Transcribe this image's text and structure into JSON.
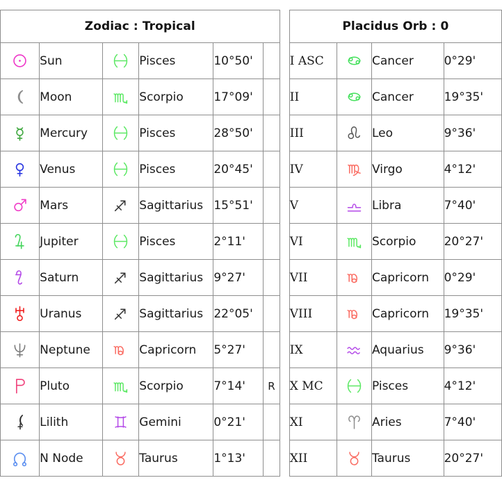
{
  "left_panel": {
    "title": "Zodiac : Tropical",
    "columns": [
      "planet_symbol",
      "planet",
      "sign_symbol",
      "sign",
      "position",
      "retrograde"
    ],
    "rows": [
      {
        "planet_symbol": "sun-symbol",
        "planet": "Sun",
        "sign_symbol": "pisces-symbol",
        "sign": "Pisces",
        "position": "10°50'",
        "retrograde": ""
      },
      {
        "planet_symbol": "moon-symbol",
        "planet": "Moon",
        "sign_symbol": "scorpio-symbol",
        "sign": "Scorpio",
        "position": "17°09'",
        "retrograde": ""
      },
      {
        "planet_symbol": "mercury-symbol",
        "planet": "Mercury",
        "sign_symbol": "pisces-symbol",
        "sign": "Pisces",
        "position": "28°50'",
        "retrograde": ""
      },
      {
        "planet_symbol": "venus-symbol",
        "planet": "Venus",
        "sign_symbol": "pisces-symbol",
        "sign": "Pisces",
        "position": "20°45'",
        "retrograde": ""
      },
      {
        "planet_symbol": "mars-symbol",
        "planet": "Mars",
        "sign_symbol": "sagittarius-symbol",
        "sign": "Sagittarius",
        "position": "15°51'",
        "retrograde": ""
      },
      {
        "planet_symbol": "jupiter-symbol",
        "planet": "Jupiter",
        "sign_symbol": "pisces-symbol",
        "sign": "Pisces",
        "position": "2°11'",
        "retrograde": ""
      },
      {
        "planet_symbol": "saturn-symbol",
        "planet": "Saturn",
        "sign_symbol": "sagittarius-symbol",
        "sign": "Sagittarius",
        "position": "9°27'",
        "retrograde": ""
      },
      {
        "planet_symbol": "uranus-symbol",
        "planet": "Uranus",
        "sign_symbol": "sagittarius-symbol",
        "sign": "Sagittarius",
        "position": "22°05'",
        "retrograde": ""
      },
      {
        "planet_symbol": "neptune-symbol",
        "planet": "Neptune",
        "sign_symbol": "capricorn-symbol",
        "sign": "Capricorn",
        "position": "5°27'",
        "retrograde": ""
      },
      {
        "planet_symbol": "pluto-symbol",
        "planet": "Pluto",
        "sign_symbol": "scorpio-symbol",
        "sign": "Scorpio",
        "position": "7°14'",
        "retrograde": "R"
      },
      {
        "planet_symbol": "lilith-symbol",
        "planet": "Lilith",
        "sign_symbol": "gemini-symbol",
        "sign": "Gemini",
        "position": "0°21'",
        "retrograde": ""
      },
      {
        "planet_symbol": "north-node-symbol",
        "planet": "N Node",
        "sign_symbol": "taurus-symbol",
        "sign": "Taurus",
        "position": "1°13'",
        "retrograde": ""
      }
    ]
  },
  "right_panel": {
    "title": "Placidus Orb : 0",
    "columns": [
      "house",
      "sign_symbol",
      "sign",
      "position"
    ],
    "rows": [
      {
        "house": "I ASC",
        "sign_symbol": "cancer-symbol",
        "sign": "Cancer",
        "position": "0°29'"
      },
      {
        "house": "II",
        "sign_symbol": "cancer-symbol",
        "sign": "Cancer",
        "position": "19°35'"
      },
      {
        "house": "III",
        "sign_symbol": "leo-symbol",
        "sign": "Leo",
        "position": "9°36'"
      },
      {
        "house": "IV",
        "sign_symbol": "virgo-symbol",
        "sign": "Virgo",
        "position": "4°12'"
      },
      {
        "house": "V",
        "sign_symbol": "libra-symbol",
        "sign": "Libra",
        "position": "7°40'"
      },
      {
        "house": "VI",
        "sign_symbol": "scorpio-symbol",
        "sign": "Scorpio",
        "position": "20°27'"
      },
      {
        "house": "VII",
        "sign_symbol": "capricorn-symbol",
        "sign": "Capricorn",
        "position": "0°29'"
      },
      {
        "house": "VIII",
        "sign_symbol": "capricorn-symbol",
        "sign": "Capricorn",
        "position": "19°35'"
      },
      {
        "house": "IX",
        "sign_symbol": "aquarius-symbol",
        "sign": "Aquarius",
        "position": "9°36'"
      },
      {
        "house": "X MC",
        "sign_symbol": "pisces-symbol",
        "sign": "Pisces",
        "position": "4°12'"
      },
      {
        "house": "XI",
        "sign_symbol": "aries-symbol",
        "sign": "Aries",
        "position": "7°40'"
      },
      {
        "house": "XII",
        "sign_symbol": "taurus-symbol",
        "sign": "Taurus",
        "position": "20°27'"
      }
    ]
  },
  "glyph_colors": {
    "sun-symbol": "#ee36c8",
    "moon-symbol": "#8e8e8e",
    "mercury-symbol": "#3fa83f",
    "venus-symbol": "#2633e0",
    "mars-symbol": "#f03fc8",
    "jupiter-symbol": "#44d45c",
    "saturn-symbol": "#b44ae8",
    "uranus-symbol": "#f02020",
    "neptune-symbol": "#7d7d7d",
    "pluto-symbol": "#f0407a",
    "lilith-symbol": "#333333",
    "north-node-symbol": "#5a8ef0",
    "aries-symbol": "#8e8e8e",
    "taurus-symbol": "#fa6a60",
    "gemini-symbol": "#b44ae8",
    "cancer-symbol": "#44e05c",
    "leo-symbol": "#555555",
    "virgo-symbol": "#fa6a60",
    "libra-symbol": "#b44ae8",
    "scorpio-symbol": "#5ce864",
    "sagittarius-symbol": "#333333",
    "capricorn-symbol": "#fa6a60",
    "aquarius-symbol": "#b44ae8",
    "pisces-symbol": "#5ce864"
  },
  "glyph_chars": {
    "sun-symbol": "☉",
    "moon-symbol": "☽",
    "mercury-symbol": "☿",
    "venus-symbol": "♀",
    "mars-symbol": "♂",
    "jupiter-symbol": "♃",
    "saturn-symbol": "♄",
    "uranus-symbol": "⛢",
    "neptune-symbol": "♆",
    "pluto-symbol": "♇",
    "lilith-symbol": "⚸",
    "north-node-symbol": "☊",
    "aries-symbol": "♈",
    "taurus-symbol": "♉",
    "gemini-symbol": "♊",
    "cancer-symbol": "♋",
    "leo-symbol": "♌",
    "virgo-symbol": "♍",
    "libra-symbol": "♎",
    "scorpio-symbol": "♏",
    "sagittarius-symbol": "♐",
    "capricorn-symbol": "♑",
    "aquarius-symbol": "♒",
    "pisces-symbol": "♓"
  }
}
